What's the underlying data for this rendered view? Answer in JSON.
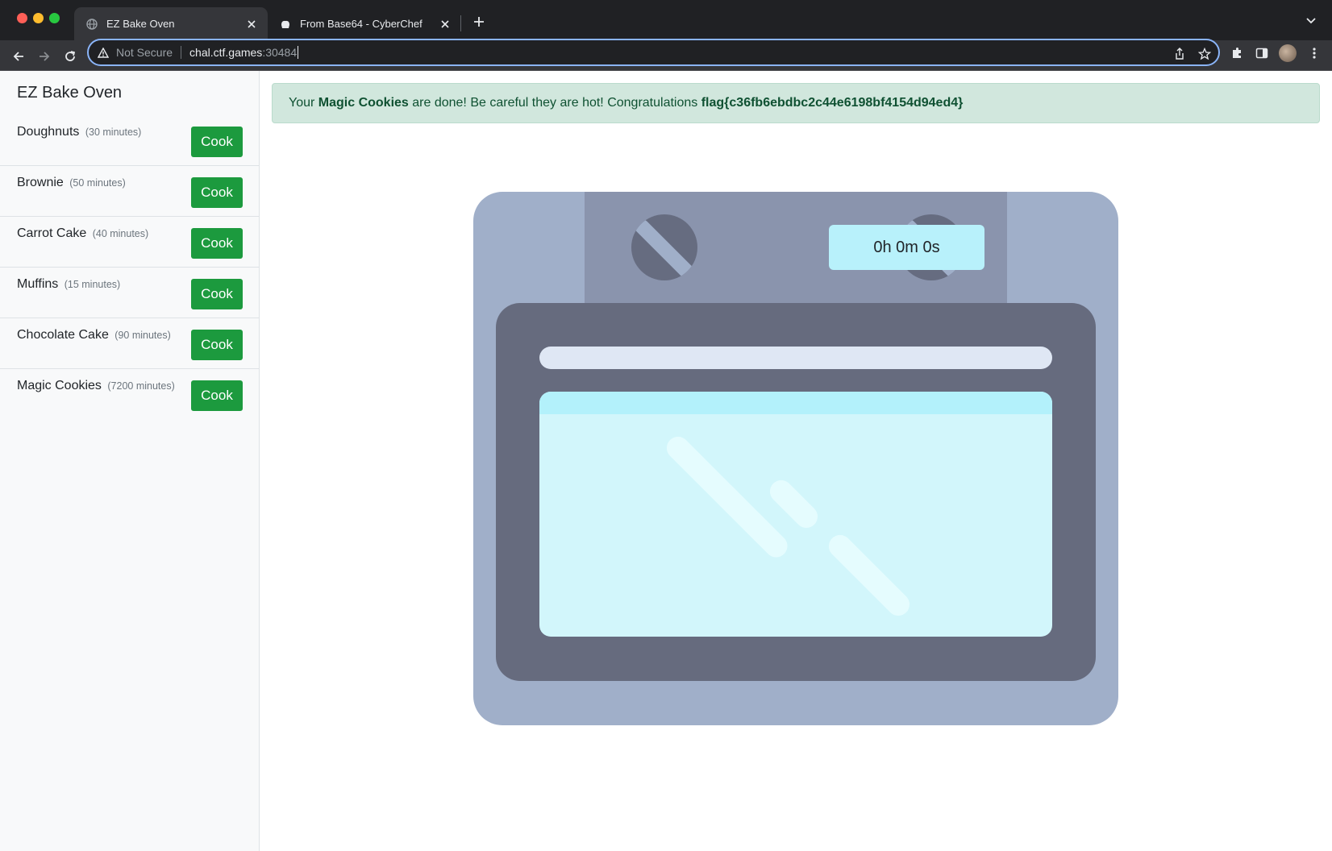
{
  "browser": {
    "tabs": [
      {
        "title": "EZ Bake Oven",
        "active": true
      },
      {
        "title": "From Base64 - CyberChef",
        "active": false
      }
    ],
    "address": {
      "security_label": "Not Secure",
      "host": "chal.ctf.games",
      "port": ":30484"
    }
  },
  "app": {
    "title": "EZ Bake Oven",
    "items": [
      {
        "name": "Doughnuts",
        "duration": "(30 minutes)",
        "button": "Cook"
      },
      {
        "name": "Brownie",
        "duration": "(50 minutes)",
        "button": "Cook"
      },
      {
        "name": "Carrot Cake",
        "duration": "(40 minutes)",
        "button": "Cook"
      },
      {
        "name": "Muffins",
        "duration": "(15 minutes)",
        "button": "Cook"
      },
      {
        "name": "Chocolate Cake",
        "duration": "(90 minutes)",
        "button": "Cook"
      },
      {
        "name": "Magic Cookies",
        "duration": "(7200 minutes)",
        "button": "Cook"
      }
    ],
    "alert": {
      "prefix": "Your",
      "item": "Magic Cookies",
      "middle": "are done! Be careful they are hot! Congratulations",
      "flag": "flag{c36fb6ebdbc2c44e6198bf4154d94ed4}"
    },
    "oven": {
      "timer": "0h 0m 0s"
    }
  },
  "colors": {
    "cook_button": "#1c9a3e",
    "alert_bg": "#d1e7dd",
    "alert_text": "#0f5132",
    "oven_body": "#a0afc9",
    "oven_door": "#666b7e",
    "oven_window": "#d2f6fb",
    "timer_bg": "#b8f1fb"
  },
  "icons": [
    "globe-icon",
    "cyberchef-icon",
    "close-icon",
    "plus-icon",
    "chevron-down-icon",
    "back-arrow-icon",
    "forward-arrow-icon",
    "reload-icon",
    "warning-icon",
    "share-icon",
    "star-icon",
    "extensions-icon",
    "side-panel-icon",
    "avatar",
    "more-icon"
  ]
}
